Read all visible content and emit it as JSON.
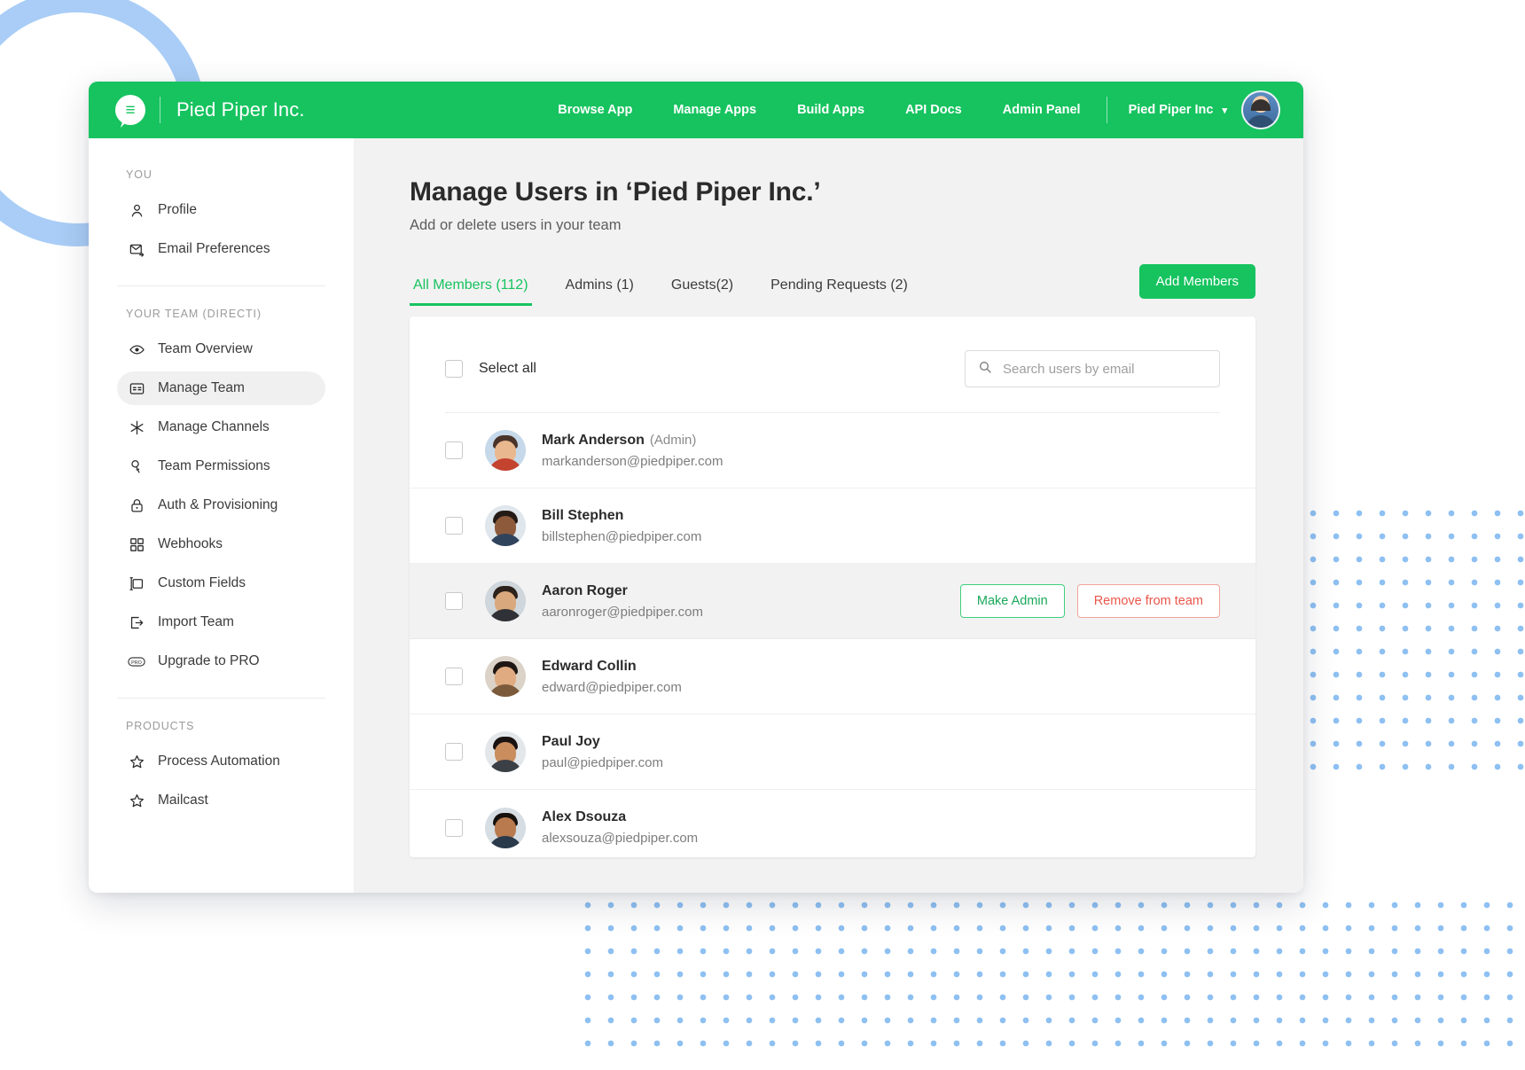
{
  "topbar": {
    "brand": "Pied Piper Inc.",
    "logo_icon": "piper-speech-bubble-icon",
    "nav": [
      {
        "label": "Browse App"
      },
      {
        "label": "Manage Apps"
      },
      {
        "label": "Build Apps"
      },
      {
        "label": "API Docs"
      },
      {
        "label": "Admin Panel"
      }
    ],
    "account_label": "Pied Piper Inc",
    "account_caret": "▾",
    "avatar_name": "user-avatar"
  },
  "sidebar": {
    "sections": [
      {
        "title": "YOU",
        "items": [
          {
            "label": "Profile",
            "icon": "person-icon",
            "active": false
          },
          {
            "label": "Email Preferences",
            "icon": "envelope-arrow-icon",
            "active": false
          }
        ]
      },
      {
        "title": "YOUR TEAM (DIRECTI)",
        "items": [
          {
            "label": "Team Overview",
            "icon": "eye-icon",
            "active": false
          },
          {
            "label": "Manage Team",
            "icon": "id-card-icon",
            "active": true
          },
          {
            "label": "Manage Channels",
            "icon": "asterisk-icon",
            "active": false
          },
          {
            "label": "Team Permissions",
            "icon": "key-icon",
            "active": false
          },
          {
            "label": "Auth & Provisioning",
            "icon": "lock-icon",
            "active": false
          },
          {
            "label": "Webhooks",
            "icon": "grid-squares-icon",
            "active": false
          },
          {
            "label": "Custom Fields",
            "icon": "form-field-icon",
            "active": false
          },
          {
            "label": "Import Team",
            "icon": "arrow-into-box-icon",
            "active": false
          },
          {
            "label": "Upgrade to PRO",
            "icon": "pro-badge-icon",
            "active": false
          }
        ]
      },
      {
        "title": "PRODUCTS",
        "items": [
          {
            "label": "Process Automation",
            "icon": "star-icon",
            "active": false
          },
          {
            "label": "Mailcast",
            "icon": "star-icon",
            "active": false
          }
        ]
      }
    ]
  },
  "main": {
    "title": "Manage Users in ‘Pied Piper Inc.’",
    "subtitle": "Add or delete users in your team",
    "tabs": [
      {
        "label": "All Members (112)",
        "active": true
      },
      {
        "label": "Admins (1)",
        "active": false
      },
      {
        "label": "Guests(2)",
        "active": false
      },
      {
        "label": "Pending Requests (2)",
        "active": false
      }
    ],
    "add_members_label": "Add Members",
    "select_all_label": "Select all",
    "search": {
      "placeholder": "Search users by email",
      "value": "",
      "icon": "search-icon"
    },
    "row_actions": {
      "make_admin_label": "Make Admin",
      "remove_label": "Remove from team"
    },
    "users": [
      {
        "name": "Mark Anderson",
        "role": "(Admin)",
        "email": "markanderson@piedpiper.com",
        "selected": false,
        "highlight": false,
        "show_actions": false,
        "skin": "#e9b88f",
        "hair": "#4a342a",
        "shirt": "#c3432f",
        "bg": "#c6d9ea"
      },
      {
        "name": "Bill Stephen",
        "role": "",
        "email": "billstephen@piedpiper.com",
        "selected": false,
        "highlight": false,
        "show_actions": false,
        "skin": "#8d5b3c",
        "hair": "#241a16",
        "shirt": "#30435c",
        "bg": "#dfe6ec"
      },
      {
        "name": "Aaron Roger",
        "role": "",
        "email": "aaronroger@piedpiper.com",
        "selected": false,
        "highlight": true,
        "show_actions": true,
        "skin": "#d9a87c",
        "hair": "#2c211b",
        "shirt": "#2f3136",
        "bg": "#cfd6dc"
      },
      {
        "name": "Edward Collin",
        "role": "",
        "email": "edward@piedpiper.com",
        "selected": false,
        "highlight": false,
        "show_actions": false,
        "skin": "#e0ab81",
        "hair": "#1f1713",
        "shirt": "#7b5a3c",
        "bg": "#dcd3c8"
      },
      {
        "name": "Paul Joy",
        "role": "",
        "email": "paul@piedpiper.com",
        "selected": false,
        "highlight": false,
        "show_actions": false,
        "skin": "#c98d5e",
        "hair": "#191210",
        "shirt": "#3b3f46",
        "bg": "#e3e7ea"
      },
      {
        "name": "Alex Dsouza",
        "role": "",
        "email": "alexsouza@piedpiper.com",
        "selected": false,
        "highlight": false,
        "show_actions": false,
        "skin": "#b97a4e",
        "hair": "#17110e",
        "shirt": "#2b3a4a",
        "bg": "#d6dde3"
      }
    ]
  },
  "colors": {
    "brand_green": "#16c35f",
    "accent_green_text": "#16c35f",
    "danger_red": "#e9564a",
    "deco_blue": "#8ec0f2"
  }
}
